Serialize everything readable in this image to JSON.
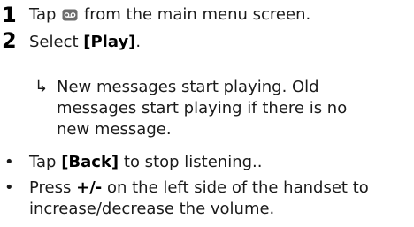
{
  "steps": [
    {
      "number": "1",
      "pre": "Tap ",
      "icon": "voicemail-icon",
      "post": " from the main menu screen."
    },
    {
      "number": "2",
      "pre": "Select ",
      "bold": "[Play]",
      "post": ".",
      "result_arrow": "↳",
      "result_lines": [
        "New messages start playing. Old",
        "messages start playing if there is no",
        "new message."
      ]
    }
  ],
  "bullets": [
    {
      "symbol": "•",
      "pre": "Tap ",
      "bold": "[Back]",
      "post": " to stop listening.."
    },
    {
      "symbol": "•",
      "pre": "Press ",
      "bold": "+/-",
      "post": " on the left side of the handset to",
      "line2": "increase/decrease the volume."
    }
  ],
  "colors": {
    "text": "#1a1a1a",
    "icon_fill": "#6b6b6b"
  }
}
